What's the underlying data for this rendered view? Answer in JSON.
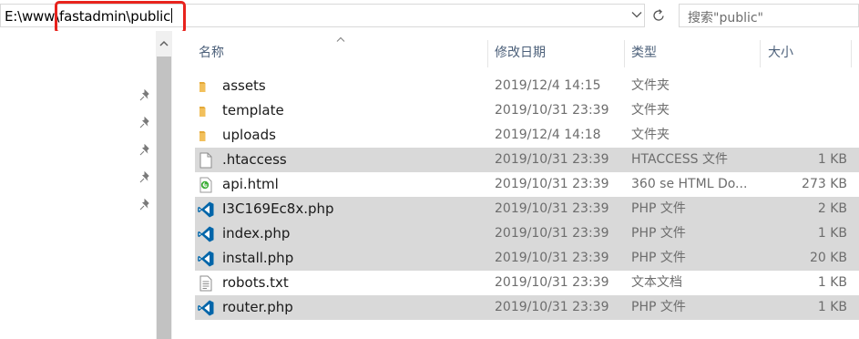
{
  "address_bar": {
    "path": "E:\\www\\fastadmin\\public"
  },
  "search": {
    "placeholder": "搜索\"public\""
  },
  "columns": {
    "name": "名称",
    "modified": "修改日期",
    "type": "类型",
    "size": "大小"
  },
  "files": [
    {
      "name": "assets",
      "modified": "2019/12/4 14:15",
      "type": "文件夹",
      "size": "",
      "icon": "folder-icon",
      "selected": false
    },
    {
      "name": "template",
      "modified": "2019/10/31 23:39",
      "type": "文件夹",
      "size": "",
      "icon": "folder-icon",
      "selected": false
    },
    {
      "name": "uploads",
      "modified": "2019/12/4 14:18",
      "type": "文件夹",
      "size": "",
      "icon": "folder-icon",
      "selected": false
    },
    {
      "name": ".htaccess",
      "modified": "2019/10/31 23:39",
      "type": "HTACCESS 文件",
      "size": "1 KB",
      "icon": "blank-file-icon",
      "selected": true
    },
    {
      "name": "api.html",
      "modified": "2019/10/31 23:39",
      "type": "360 se HTML Do...",
      "size": "273 KB",
      "icon": "html-file-icon",
      "selected": false
    },
    {
      "name": "I3C169Ec8x.php",
      "modified": "2019/10/31 23:39",
      "type": "PHP 文件",
      "size": "2 KB",
      "icon": "vscode-icon",
      "selected": true
    },
    {
      "name": "index.php",
      "modified": "2019/10/31 23:39",
      "type": "PHP 文件",
      "size": "1 KB",
      "icon": "vscode-icon",
      "selected": true
    },
    {
      "name": "install.php",
      "modified": "2019/10/31 23:39",
      "type": "PHP 文件",
      "size": "20 KB",
      "icon": "vscode-icon",
      "selected": true
    },
    {
      "name": "robots.txt",
      "modified": "2019/10/31 23:39",
      "type": "文本文档",
      "size": "1 KB",
      "icon": "text-file-icon",
      "selected": false
    },
    {
      "name": "router.php",
      "modified": "2019/10/31 23:39",
      "type": "PHP 文件",
      "size": "1 KB",
      "icon": "vscode-icon",
      "selected": true
    }
  ],
  "colors": {
    "highlight_box": "#e8231d",
    "selected_row": "#d9d9d9",
    "header_text": "#4c607a",
    "vscode_blue": "#0065a9",
    "folder": "#f2c05c"
  }
}
